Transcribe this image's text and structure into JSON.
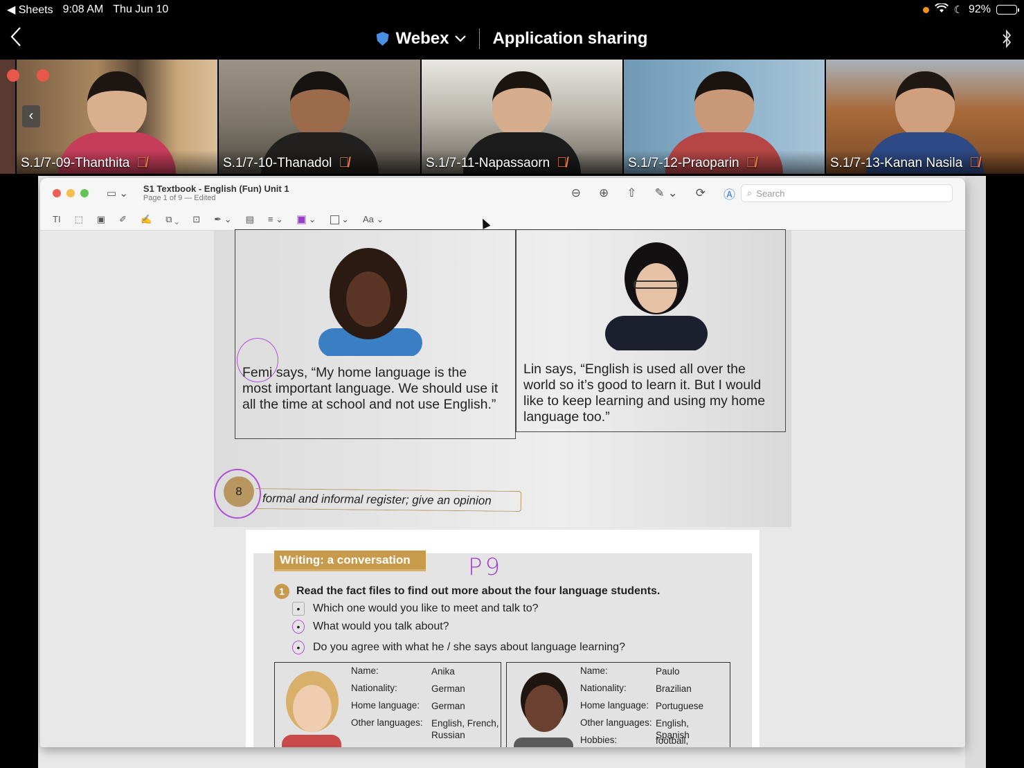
{
  "status_bar": {
    "back_app": "◀ Sheets",
    "time": "9:08 AM",
    "date": "Thu Jun 10",
    "battery": "92%",
    "battery_level": 0.92
  },
  "header": {
    "app_name": "Webex",
    "section_title": "Application sharing"
  },
  "participants": [
    {
      "name": "S.1/7-09-Thanthita",
      "muted": true
    },
    {
      "name": "S.1/7-10-Thanadol",
      "muted": true
    },
    {
      "name": "S.1/7-11-Napassaorn",
      "muted": true
    },
    {
      "name": "S.1/7-12-Praoparin",
      "muted": true
    },
    {
      "name": "S.1/7-13-Kanan Nasila",
      "muted": true
    }
  ],
  "preview": {
    "doc_title": "S1 Textbook - English (Fun) Unit 1",
    "doc_subtitle": "Page 1 of 9 — Edited",
    "search_placeholder": "Search",
    "font_button": "Aa"
  },
  "page1": {
    "femi_quote": "Femi says, “My home language is the most important language. We should use it all the time at school and not use English.”",
    "lin_quote": "Lin says, “English is used all over the world so it’s good to learn it. But I would like to keep learning and using my home language too.”",
    "lesson_number": "8",
    "lesson_banner": "formal and informal register; give an opinion"
  },
  "page2": {
    "section_heading": "Writing: a conversation",
    "handwritten_note": "P9",
    "question_number": "1",
    "question": "Read the fact files to find out more about the four language students.",
    "bullets": [
      "Which one would you like to meet and talk to?",
      "What would you talk about?",
      "Do you agree with what he / she says about language learning?"
    ],
    "fact_files": [
      {
        "rows": [
          {
            "key": "Name:",
            "value": "Anika"
          },
          {
            "key": "Nationality:",
            "value": "German"
          },
          {
            "key": "Home language:",
            "value": "German"
          },
          {
            "key": "Other languages:",
            "value": "English, French, Russian"
          }
        ]
      },
      {
        "rows": [
          {
            "key": "Name:",
            "value": "Paulo"
          },
          {
            "key": "Nationality:",
            "value": "Brazilian"
          },
          {
            "key": "Home language:",
            "value": "Portuguese"
          },
          {
            "key": "Other languages:",
            "value": "English, Spanish"
          },
          {
            "key": "Hobbies:",
            "value": "football,"
          }
        ]
      }
    ]
  }
}
